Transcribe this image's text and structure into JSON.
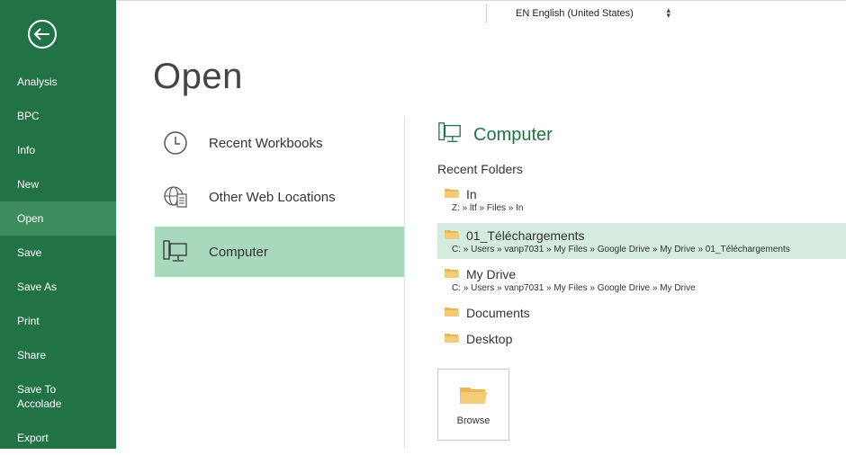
{
  "language": {
    "label": "EN English (United States)"
  },
  "nav": {
    "items": [
      {
        "label": "Analysis"
      },
      {
        "label": "BPC"
      },
      {
        "label": "Info"
      },
      {
        "label": "New"
      },
      {
        "label": "Open"
      },
      {
        "label": "Save"
      },
      {
        "label": "Save As"
      },
      {
        "label": "Print"
      },
      {
        "label": "Share"
      },
      {
        "label": "Save To Accolade"
      },
      {
        "label": "Export"
      }
    ],
    "active": "Open"
  },
  "page": {
    "title": "Open"
  },
  "places": [
    {
      "label": "Recent Workbooks",
      "icon": "clock-icon"
    },
    {
      "label": "Other Web Locations",
      "icon": "globe-doc-icon"
    },
    {
      "label": "Computer",
      "icon": "computer-icon",
      "selected": true
    }
  ],
  "right": {
    "title": "Computer",
    "recent_label": "Recent Folders",
    "folders": [
      {
        "name": "In",
        "path": "Z: » ltf » Files » In"
      },
      {
        "name": "01_Téléchargements",
        "path": "C: » Users » vanp7031 » My Files » Google Drive » My Drive » 01_Téléchargements",
        "selected": true
      },
      {
        "name": "My Drive",
        "path": "C: » Users » vanp7031 » My Files » Google Drive » My Drive"
      },
      {
        "name": "Documents",
        "path": ""
      },
      {
        "name": "Desktop",
        "path": ""
      }
    ],
    "browse_label": "Browse"
  },
  "colors": {
    "nav_bg": "#217346",
    "nav_active": "#3f8c5e",
    "place_selected": "#a9d9bd",
    "folder_selected": "#d5ebdd",
    "accent_text": "#217346",
    "folder_icon": "#e8b75a"
  }
}
